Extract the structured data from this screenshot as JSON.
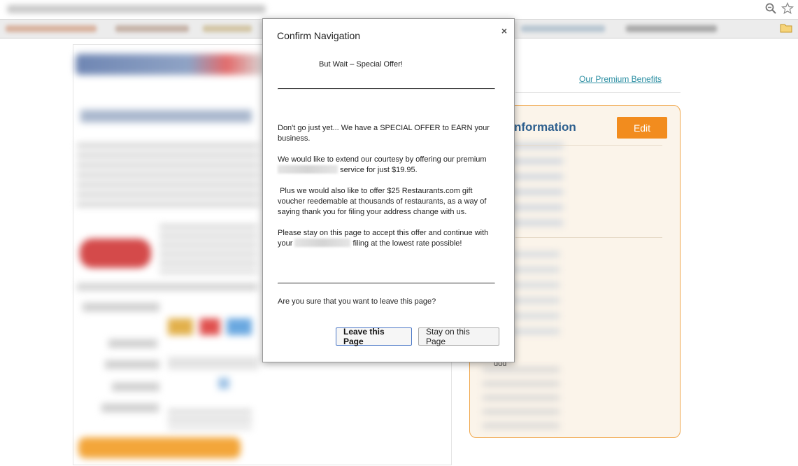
{
  "browser": {
    "icons": [
      "zoom-icon",
      "star-icon",
      "folder-icon"
    ]
  },
  "page": {
    "premium_link": "Our Premium Benefits",
    "info_title": "nformation",
    "edit_button": "Edit",
    "fragment_text": "ddd",
    "colors": {
      "accent": "#f28c1e",
      "box_border": "#f0a64a",
      "title": "#2d5f8e",
      "link": "#2c8fa3"
    }
  },
  "dialog": {
    "title": "Confirm Navigation",
    "close_glyph": "×",
    "heading": "But Wait – Special Offer!",
    "p1": "Don't go just yet... We have a SPECIAL OFFER to EARN your business.",
    "p2_before": "We would like to extend our courtesy by offering our premium",
    "p2_after": "service for just $19.95.",
    "p3": " Plus we would also like to offer $25 Restaurants.com gift voucher reedemable at thousands of restaurants, as a way of saying thank you for filing your address change with us.",
    "p4_before": "Please stay on this page to accept this offer and continue with your",
    "p4_after": "filing at the lowest rate possible!",
    "question": "Are you sure that you want to leave this page?",
    "leave_button": "Leave this Page",
    "stay_button": "Stay on this Page"
  }
}
